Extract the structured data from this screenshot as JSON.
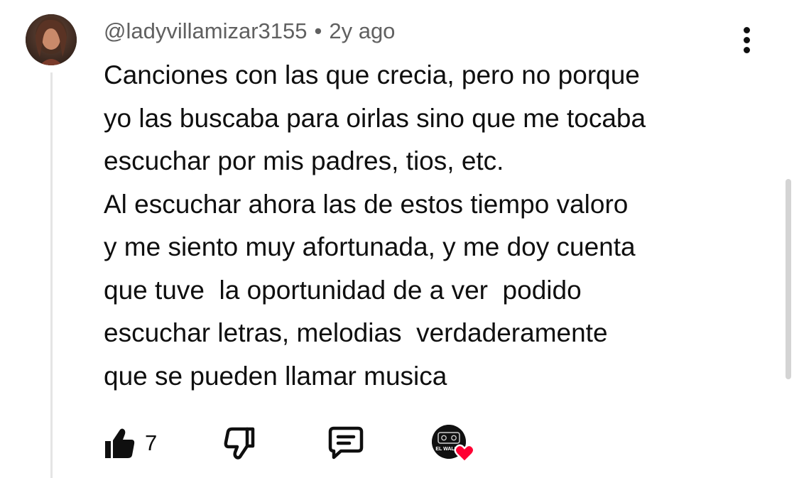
{
  "comment": {
    "author": "@ladyvillamizar3155",
    "separator": "•",
    "timestamp": "2y ago",
    "text": "Canciones con las que crecia, pero no porque\nyo las buscaba para oirlas sino que me tocaba\nescuchar por mis padres, tios, etc.\nAl escuchar ahora las de estos tiempo valoro\ny me siento muy afortunada, y me doy cuenta\nque tuve  la oportunidad de a ver  podido\nescuchar letras, melodias  verdaderamente\nque se pueden llamar musica"
  },
  "actions": {
    "like_count": "7",
    "like_icon": "thumbs-up-filled-icon",
    "dislike_icon": "thumbs-down-outline-icon",
    "reply_icon": "reply-comment-icon",
    "more_icon": "vertical-dots-icon"
  },
  "creator_heart": {
    "channel_logo_text": "EL WALKM",
    "heart_color": "#ff0033"
  }
}
